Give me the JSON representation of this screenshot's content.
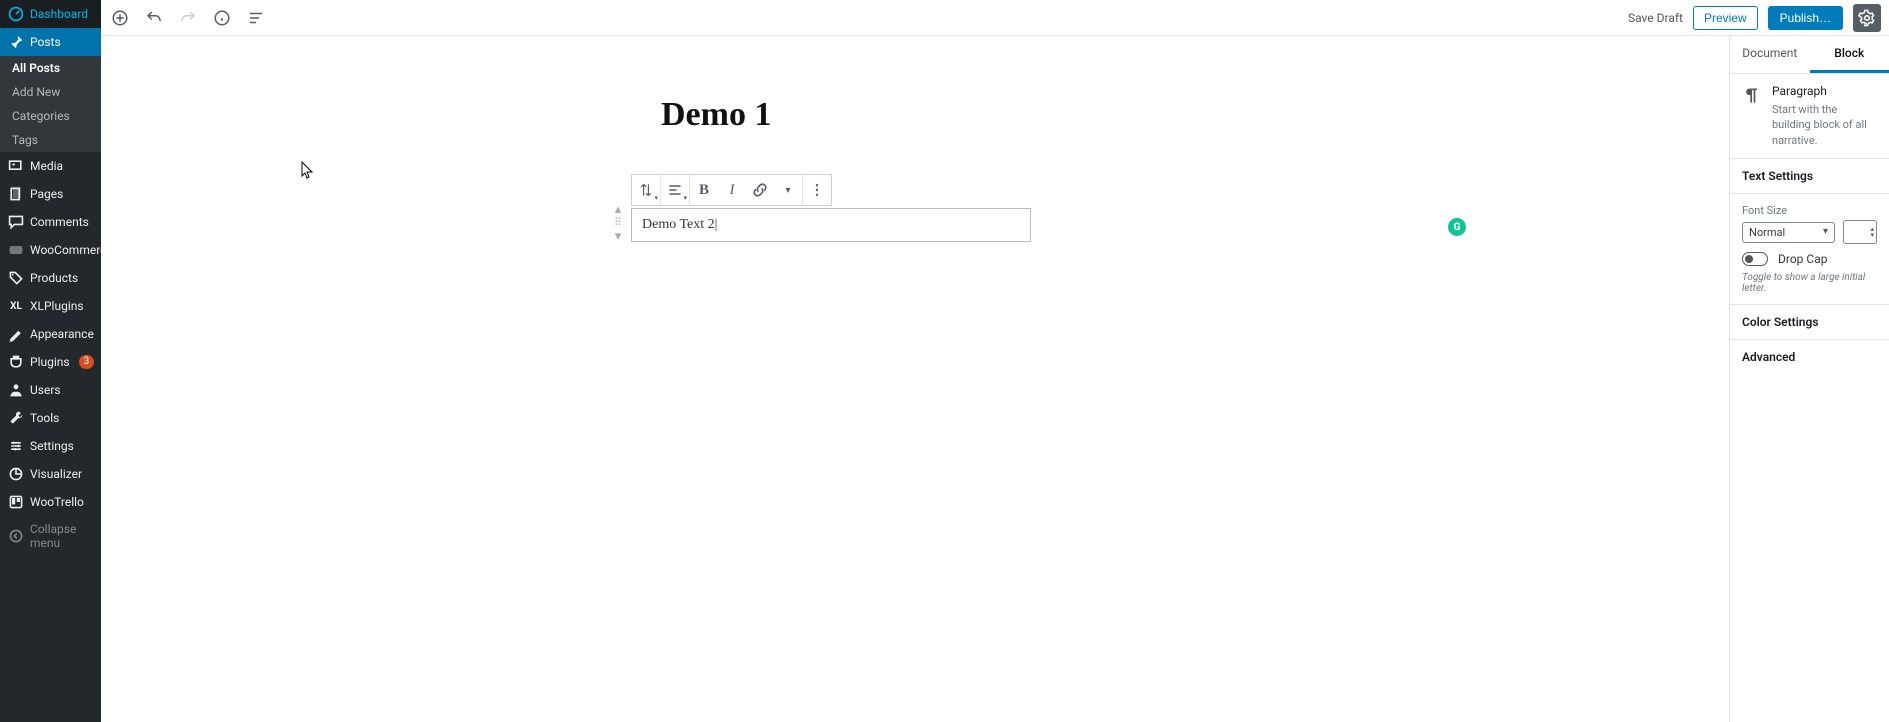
{
  "sidebar": {
    "items": [
      {
        "label": "Dashboard",
        "icon": "dashboard"
      },
      {
        "label": "Posts",
        "icon": "pin",
        "current": true,
        "submenu": [
          {
            "label": "All Posts",
            "current": true
          },
          {
            "label": "Add New"
          },
          {
            "label": "Categories"
          },
          {
            "label": "Tags"
          }
        ]
      },
      {
        "label": "Media",
        "icon": "media"
      },
      {
        "label": "Pages",
        "icon": "pages"
      },
      {
        "label": "Comments",
        "icon": "comments"
      },
      {
        "label": "WooCommerce",
        "icon": "woo"
      },
      {
        "label": "Products",
        "icon": "products"
      },
      {
        "label": "XLPlugins",
        "icon": "xl"
      },
      {
        "label": "Appearance",
        "icon": "appearance"
      },
      {
        "label": "Plugins",
        "icon": "plugins",
        "badge": "3"
      },
      {
        "label": "Users",
        "icon": "users"
      },
      {
        "label": "Tools",
        "icon": "tools"
      },
      {
        "label": "Settings",
        "icon": "settings"
      },
      {
        "label": "Visualizer",
        "icon": "visualizer"
      },
      {
        "label": "WooTrello",
        "icon": "wootrello"
      }
    ],
    "collapse": "Collapse menu"
  },
  "topbar": {
    "save_draft": "Save Draft",
    "preview": "Preview",
    "publish": "Publish…"
  },
  "editor": {
    "title": "Demo 1",
    "paragraph_text": "Demo Text 2"
  },
  "settings": {
    "tabs": {
      "document": "Document",
      "block": "Block"
    },
    "block_type": "Paragraph",
    "block_desc": "Start with the building block of all narrative.",
    "sections": {
      "text_settings": "Text Settings",
      "font_size": "Font Size",
      "font_size_value": "Normal",
      "drop_cap": "Drop Cap",
      "drop_cap_hint": "Toggle to show a large initial letter.",
      "color_settings": "Color Settings",
      "advanced": "Advanced"
    }
  }
}
